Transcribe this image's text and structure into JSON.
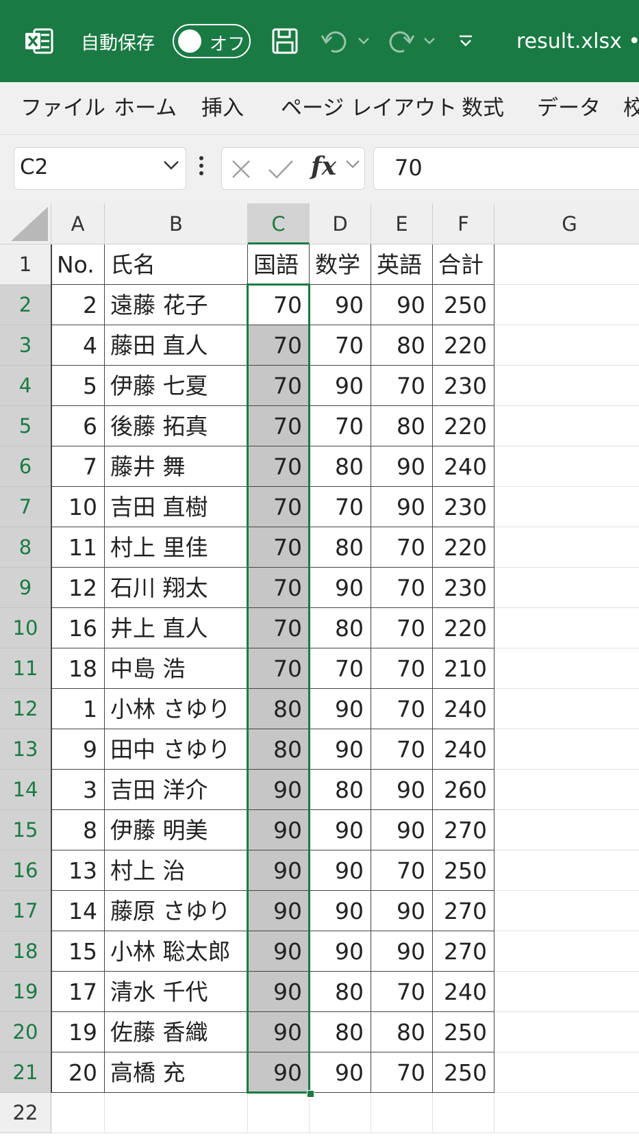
{
  "title_bar": {
    "autosave_label": "自動保存",
    "toggle_state": "オフ",
    "filename": "result.xlsx •"
  },
  "ribbon": {
    "tabs": [
      "ファイル",
      "ホーム",
      "挿入",
      "ページ レイアウト",
      "数式",
      "データ",
      "校"
    ]
  },
  "formula_bar": {
    "name_box": "C2",
    "fx_label": "fx",
    "formula_value": "70"
  },
  "grid": {
    "column_letters": [
      "A",
      "B",
      "C",
      "D",
      "E",
      "F",
      "G"
    ],
    "selected_column": "C",
    "header_row": [
      "No.",
      "氏名",
      "国語",
      "数学",
      "英語",
      "合計"
    ],
    "rows": [
      [
        "2",
        "遠藤 花子",
        "70",
        "90",
        "90",
        "250"
      ],
      [
        "4",
        "藤田 直人",
        "70",
        "70",
        "80",
        "220"
      ],
      [
        "5",
        "伊藤 七夏",
        "70",
        "90",
        "70",
        "230"
      ],
      [
        "6",
        "後藤 拓真",
        "70",
        "70",
        "80",
        "220"
      ],
      [
        "7",
        "藤井 舞",
        "70",
        "80",
        "90",
        "240"
      ],
      [
        "10",
        "吉田 直樹",
        "70",
        "70",
        "90",
        "230"
      ],
      [
        "11",
        "村上 里佳",
        "70",
        "80",
        "70",
        "220"
      ],
      [
        "12",
        "石川 翔太",
        "70",
        "90",
        "70",
        "230"
      ],
      [
        "16",
        "井上 直人",
        "70",
        "80",
        "70",
        "220"
      ],
      [
        "18",
        "中島 浩",
        "70",
        "70",
        "70",
        "210"
      ],
      [
        "1",
        "小林 さゆり",
        "80",
        "90",
        "70",
        "240"
      ],
      [
        "9",
        "田中 さゆり",
        "80",
        "90",
        "70",
        "240"
      ],
      [
        "3",
        "吉田 洋介",
        "90",
        "80",
        "90",
        "260"
      ],
      [
        "8",
        "伊藤 明美",
        "90",
        "90",
        "90",
        "270"
      ],
      [
        "13",
        "村上 治",
        "90",
        "90",
        "70",
        "250"
      ],
      [
        "14",
        "藤原 さゆり",
        "90",
        "90",
        "90",
        "270"
      ],
      [
        "15",
        "小林 聡太郎",
        "90",
        "90",
        "90",
        "270"
      ],
      [
        "17",
        "清水 千代",
        "90",
        "80",
        "70",
        "240"
      ],
      [
        "19",
        "佐藤 香織",
        "90",
        "80",
        "80",
        "250"
      ],
      [
        "20",
        "高橋 充",
        "90",
        "90",
        "70",
        "250"
      ]
    ],
    "row_numbers": [
      "1",
      "2",
      "3",
      "4",
      "5",
      "6",
      "7",
      "8",
      "9",
      "10",
      "11",
      "12",
      "13",
      "14",
      "15",
      "16",
      "17",
      "18",
      "19",
      "20",
      "21",
      "22"
    ]
  },
  "colors": {
    "excel_green": "#1a7a43",
    "selection_fill": "#c6c6c6"
  },
  "icons": [
    "excel-logo-icon",
    "save-icon",
    "undo-icon",
    "redo-icon",
    "customize-quick-access-icon",
    "chevron-down-icon",
    "cancel-icon",
    "enter-icon",
    "more-vert-icon"
  ]
}
